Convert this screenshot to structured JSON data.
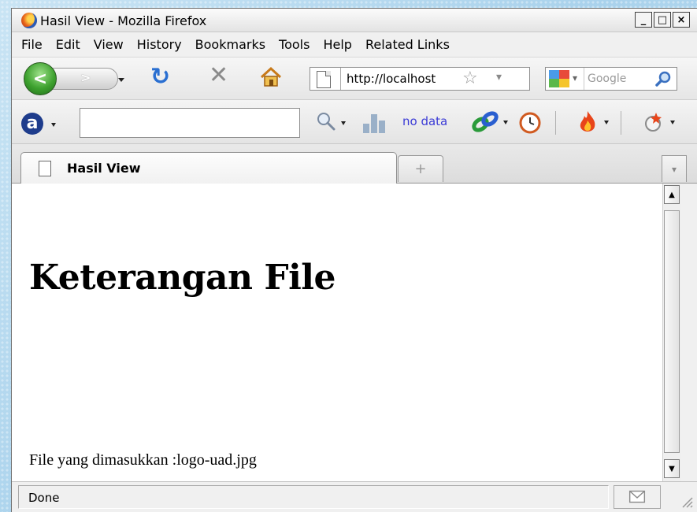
{
  "window": {
    "title": "Hasil View - Mozilla Firefox"
  },
  "controls": {
    "minimize": "_",
    "maximize": "□",
    "close": "×"
  },
  "menu": [
    {
      "label": "File"
    },
    {
      "label": "Edit"
    },
    {
      "label": "View"
    },
    {
      "label": "History"
    },
    {
      "label": "Bookmarks"
    },
    {
      "label": "Tools"
    },
    {
      "label": "Help"
    },
    {
      "label": "Related Links"
    }
  ],
  "navbar": {
    "url": "http://localhost",
    "search_placeholder": "Google"
  },
  "addon_toolbar": {
    "traffic_text": "no data"
  },
  "tabs": [
    {
      "label": "Hasil View"
    }
  ],
  "page": {
    "heading": "Keterangan File",
    "file_line": "File yang dimasukkan :logo-uad.jpg"
  },
  "status": {
    "text": "Done"
  },
  "colors": {
    "link_blue": "#3b3bd6",
    "back_green": "#3ea22f",
    "reload_blue": "#2a6fd1"
  }
}
